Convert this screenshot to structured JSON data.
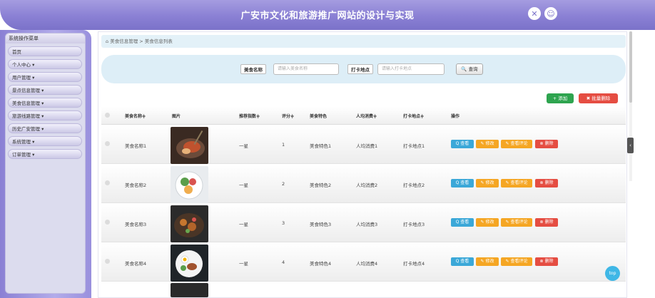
{
  "header": {
    "title": "广安市文化和旅游推广网站的设计与实现",
    "icons": [
      "settings-icon",
      "user-icon"
    ]
  },
  "sidebar": {
    "title": "系统操作菜单",
    "items": [
      {
        "label": "首页"
      },
      {
        "label": "个人中心 ▾"
      },
      {
        "label": "用户管理 ▾"
      },
      {
        "label": "景点信息管理 ▾"
      },
      {
        "label": "美食信息管理 ▾"
      },
      {
        "label": "旅游线路管理 ▾"
      },
      {
        "label": "历史广安管理 ▾"
      },
      {
        "label": "系统管理 ▾"
      },
      {
        "label": "订单管理 ▾"
      }
    ]
  },
  "breadcrumb": {
    "home_icon": "home-icon",
    "text": "美食信息管理 > 美食信息列表"
  },
  "search": {
    "name_label": "美食名称",
    "name_placeholder": "请输入美食名称",
    "place_label": "打卡地点",
    "place_placeholder": "请输入打卡地点",
    "button_label": "查询",
    "button_icon": "search-icon"
  },
  "actions": {
    "add_label": "+ 添加",
    "batch_delete_label": "✖ 批量删除"
  },
  "table": {
    "headers": [
      "美食名称≑",
      "图片",
      "推荐指数≑",
      "评分≑",
      "美食特色",
      "人均消费≑",
      "打卡地点≑",
      "操作"
    ],
    "rows": [
      {
        "name": "美食名称1",
        "recommend": "一星",
        "score": "1",
        "feature": "美食特色1",
        "avg_cost": "人均消费1",
        "location": "打卡地点1"
      },
      {
        "name": "美食名称2",
        "recommend": "一星",
        "score": "2",
        "feature": "美食特色2",
        "avg_cost": "人均消费2",
        "location": "打卡地点2"
      },
      {
        "name": "美食名称3",
        "recommend": "一星",
        "score": "3",
        "feature": "美食特色3",
        "avg_cost": "人均消费3",
        "location": "打卡地点3"
      },
      {
        "name": "美食名称4",
        "recommend": "一星",
        "score": "4",
        "feature": "美食特色4",
        "avg_cost": "人均消费4",
        "location": "打卡地点4"
      }
    ],
    "row_buttons": {
      "view": "Q 查看",
      "edit": "✎ 修改",
      "review": "✎ 查看评论",
      "delete": "⊗ 删除"
    }
  },
  "top_button": "top",
  "colors": {
    "accent_purple": "#8a80d4",
    "view_blue": "#3ba8d8",
    "edit_orange": "#f5a623",
    "delete_red": "#e54d42",
    "add_green": "#2ea44f"
  }
}
